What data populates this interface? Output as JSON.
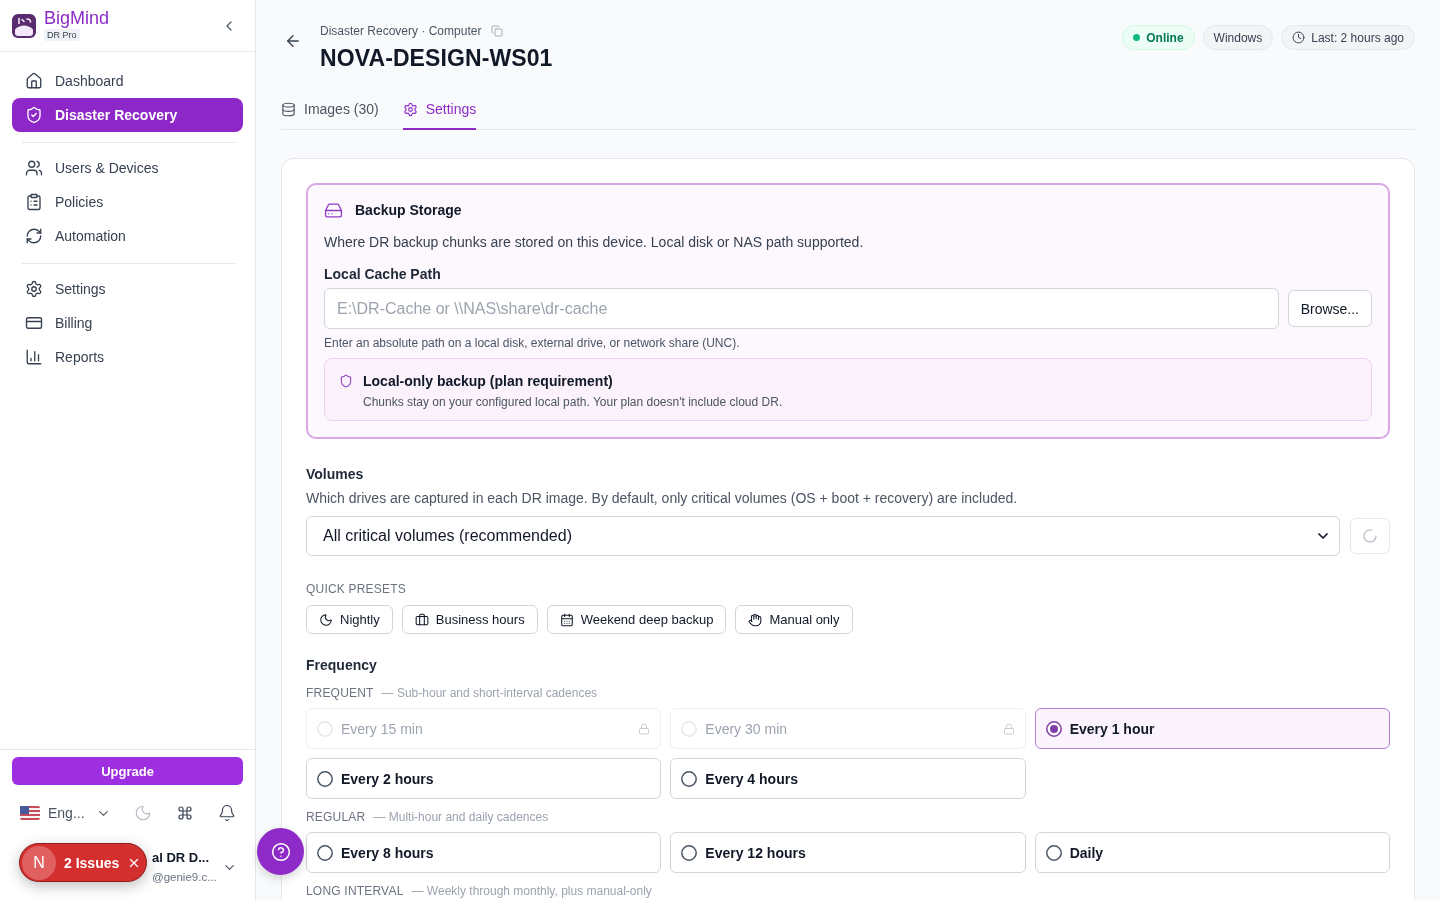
{
  "sidebar": {
    "brand": {
      "name": "BigMind",
      "plan": "DR Pro"
    },
    "nav_groups": [
      {
        "items": [
          {
            "label": "Dashboard",
            "selected": false
          },
          {
            "label": "Disaster Recovery",
            "selected": true
          }
        ]
      },
      {
        "items": [
          {
            "label": "Users & Devices",
            "selected": false
          },
          {
            "label": "Policies",
            "selected": false
          },
          {
            "label": "Automation",
            "selected": false
          }
        ]
      },
      {
        "items": [
          {
            "label": "Settings",
            "selected": false
          },
          {
            "label": "Billing",
            "selected": false
          },
          {
            "label": "Reports",
            "selected": false
          }
        ]
      }
    ],
    "upgrade_button": "Upgrade",
    "language": "Eng...",
    "user": {
      "name": "al DR D...",
      "email": "@genie9.c..."
    }
  },
  "issues_badge": {
    "initial": "N",
    "label": "2 Issues"
  },
  "header": {
    "breadcrumb": "Disaster Recovery · Computer",
    "title": "NOVA-DESIGN-WS01",
    "badges": [
      {
        "kind": "status",
        "label": "Online"
      },
      {
        "kind": "plain",
        "label": "Windows"
      },
      {
        "kind": "time",
        "label": "Last: 2 hours ago"
      }
    ]
  },
  "tabs": [
    {
      "label": "Images (30)",
      "selected": false
    },
    {
      "label": "Settings",
      "selected": true
    }
  ],
  "backup_storage": {
    "title": "Backup Storage",
    "description": "Where DR backup chunks are stored on this device. Local disk or NAS path supported.",
    "path_field": {
      "label": "Local Cache Path",
      "placeholder": "E:\\DR-Cache or \\\\NAS\\share\\dr-cache",
      "hint": "Enter an absolute path on a local disk, external drive, or network share (UNC)."
    },
    "browse_button": "Browse...",
    "notice": {
      "title": "Local-only backup (plan requirement)",
      "text": "Chunks stay on your configured local path. Your plan doesn't include cloud DR."
    }
  },
  "volumes": {
    "label": "Volumes",
    "description": "Which drives are captured in each DR image. By default, only critical volumes (OS + boot + recovery) are included.",
    "value": "All critical volumes (recommended)"
  },
  "quick_presets": {
    "heading": "QUICK PRESETS",
    "items": [
      "Nightly",
      "Business hours",
      "Weekend deep backup",
      "Manual only"
    ]
  },
  "frequency": {
    "label": "Frequency",
    "groups": [
      {
        "name": "FREQUENT",
        "description": "— Sub-hour and short-interval cadences",
        "options": [
          {
            "label": "Every 15 min",
            "selected": false,
            "disabled": true
          },
          {
            "label": "Every 30 min",
            "selected": false,
            "disabled": true
          },
          {
            "label": "Every 1 hour",
            "selected": true,
            "disabled": false
          },
          {
            "label": "Every 2 hours",
            "selected": false,
            "disabled": false
          },
          {
            "label": "Every 4 hours",
            "selected": false,
            "disabled": false
          }
        ]
      },
      {
        "name": "REGULAR",
        "description": "— Multi-hour and daily cadences",
        "options": [
          {
            "label": "Every 8 hours",
            "selected": false,
            "disabled": false
          },
          {
            "label": "Every 12 hours",
            "selected": false,
            "disabled": false
          },
          {
            "label": "Daily",
            "selected": false,
            "disabled": false
          }
        ]
      },
      {
        "name": "LONG INTERVAL",
        "description": "— Weekly through monthly, plus manual-only"
      }
    ]
  }
}
